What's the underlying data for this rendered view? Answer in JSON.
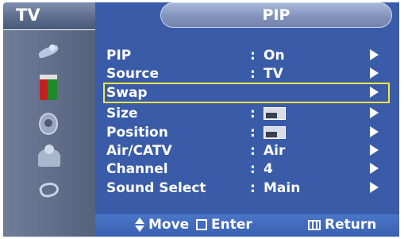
{
  "header": {
    "left_title": "TV",
    "menu_title": "PIP"
  },
  "menu": {
    "items": [
      {
        "label": "PIP",
        "value": "On",
        "has_value": true
      },
      {
        "label": "Source",
        "value": "TV",
        "has_value": true
      },
      {
        "label": "Swap",
        "value": "",
        "has_value": false,
        "selected": true
      },
      {
        "label": "Size",
        "value_icon": "size-window-icon",
        "has_value": true
      },
      {
        "label": "Position",
        "value_icon": "position-window-icon",
        "has_value": true
      },
      {
        "label": "Air/CATV",
        "value": "Air",
        "has_value": true
      },
      {
        "label": "Channel",
        "value": "4",
        "has_value": true
      },
      {
        "label": "Sound Select",
        "value": "Main",
        "has_value": true
      }
    ],
    "colon": ":"
  },
  "sidebar": {
    "icons": [
      "satellite-icon",
      "color-bars-icon",
      "speaker-icon",
      "person-icon",
      "hands-icon"
    ]
  },
  "footer": {
    "move": "Move",
    "enter": "Enter",
    "return": "Return"
  },
  "colors": {
    "menu_bg": "#3a5ca8",
    "highlight_border": "#f2e84a",
    "text": "#ffffff"
  }
}
